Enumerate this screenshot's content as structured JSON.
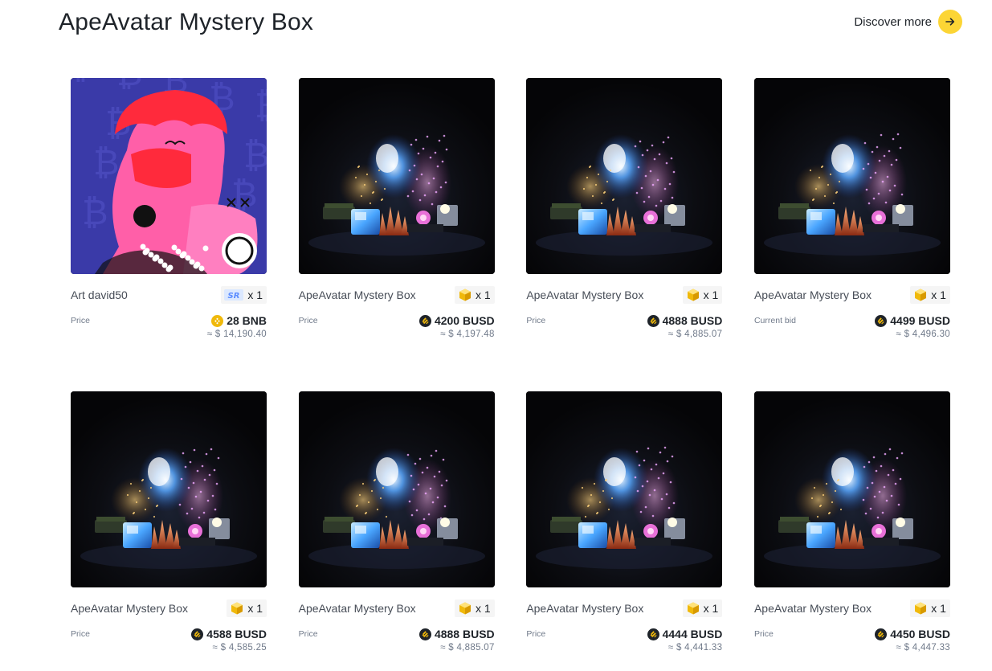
{
  "header": {
    "title": "ApeAvatar Mystery Box",
    "discover_label": "Discover more"
  },
  "colors": {
    "accent": "#fcd535",
    "text_primary": "#1e2329",
    "text_secondary": "#707a8a",
    "badge_bg": "#f5f5f5"
  },
  "cards": [
    {
      "name": "Art david50",
      "badge": "sr-icon",
      "qty": "x 1",
      "price_label": "Price",
      "price": "28 BNB",
      "coin": "bnb-coin-icon",
      "usd": "≈ $ 14,190.40",
      "image": "art-david-image"
    },
    {
      "name": "ApeAvatar Mystery Box",
      "badge": "mystery-box-icon",
      "qty": "x 1",
      "price_label": "Price",
      "price": "4200 BUSD",
      "coin": "busd-coin-icon",
      "usd": "≈ $ 4,197.48",
      "image": "mystery-box-image"
    },
    {
      "name": "ApeAvatar Mystery Box",
      "badge": "mystery-box-icon",
      "qty": "x 1",
      "price_label": "Price",
      "price": "4888 BUSD",
      "coin": "busd-coin-icon",
      "usd": "≈ $ 4,885.07",
      "image": "mystery-box-image"
    },
    {
      "name": "ApeAvatar Mystery Box",
      "badge": "mystery-box-icon",
      "qty": "x 1",
      "price_label": "Current bid",
      "price": "4499 BUSD",
      "coin": "busd-coin-icon",
      "usd": "≈ $ 4,496.30",
      "image": "mystery-box-image"
    },
    {
      "name": "ApeAvatar Mystery Box",
      "badge": "mystery-box-icon",
      "qty": "x 1",
      "price_label": "Price",
      "price": "4588 BUSD",
      "coin": "busd-coin-icon",
      "usd": "≈ $ 4,585.25",
      "image": "mystery-box-image"
    },
    {
      "name": "ApeAvatar Mystery Box",
      "badge": "mystery-box-icon",
      "qty": "x 1",
      "price_label": "Price",
      "price": "4888 BUSD",
      "coin": "busd-coin-icon",
      "usd": "≈ $ 4,885.07",
      "image": "mystery-box-image"
    },
    {
      "name": "ApeAvatar Mystery Box",
      "badge": "mystery-box-icon",
      "qty": "x 1",
      "price_label": "Price",
      "price": "4444 BUSD",
      "coin": "busd-coin-icon",
      "usd": "≈ $ 4,441.33",
      "image": "mystery-box-image"
    },
    {
      "name": "ApeAvatar Mystery Box",
      "badge": "mystery-box-icon",
      "qty": "x 1",
      "price_label": "Price",
      "price": "4450 BUSD",
      "coin": "busd-coin-icon",
      "usd": "≈ $ 4,447.33",
      "image": "mystery-box-image"
    }
  ]
}
